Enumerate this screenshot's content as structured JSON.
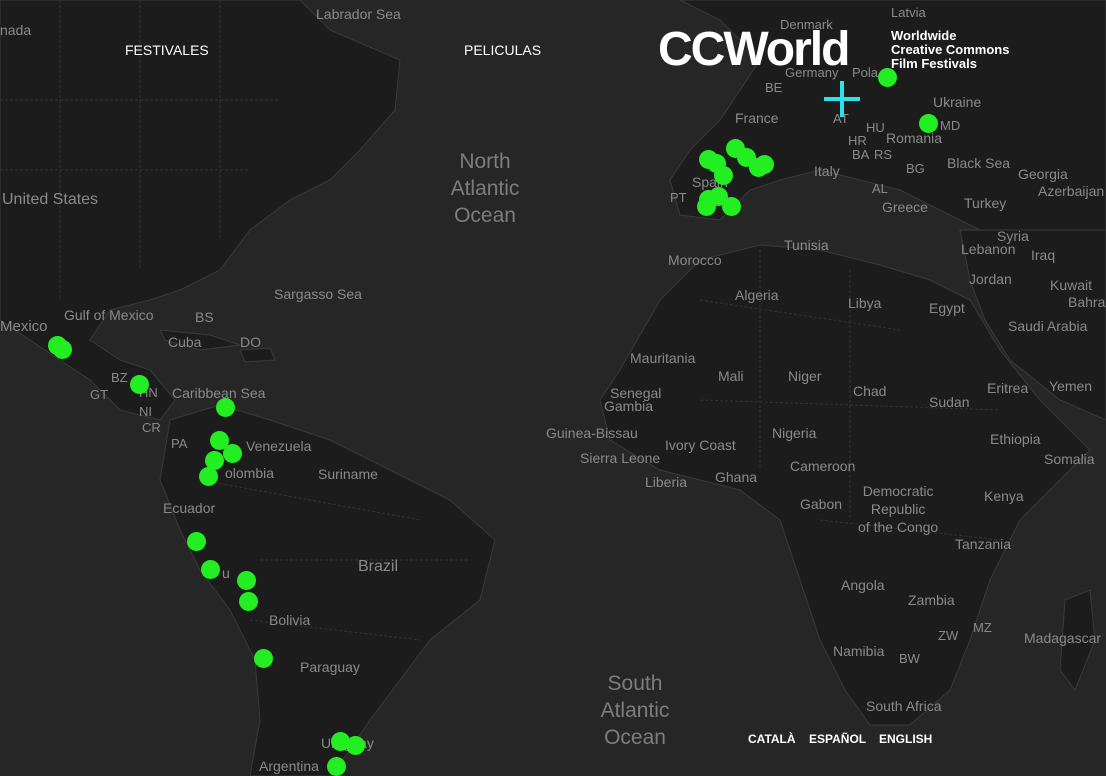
{
  "nav": {
    "festivales": "FESTIVALES",
    "peliculas": "PELICULAS"
  },
  "logo": {
    "wordmark": "CCWorld",
    "tagline": [
      "Worldwide",
      "Creative Commons",
      "Film Festivals"
    ]
  },
  "languages": [
    "CATALÀ",
    "ESPAÑOL",
    "ENGLISH"
  ],
  "colors": {
    "background": "#262626",
    "land": "#1c1c1c",
    "marker": "#22ee22",
    "crosshair": "#2ee0e8"
  },
  "oceans": {
    "north_atlantic": [
      "North",
      "Atlantic",
      "Ocean"
    ],
    "south_atlantic": [
      "South",
      "Atlantic",
      "Ocean"
    ]
  },
  "labels": {
    "labrador_sea": "Labrador Sea",
    "nada": "nada",
    "united_states": "United States",
    "mexico": "Mexico",
    "gulf_of_mexico": "Gulf of Mexico",
    "bs": "BS",
    "cuba": "Cuba",
    "do": "DO",
    "sargasso_sea": "Sargasso Sea",
    "bz": "BZ",
    "gt": "GT",
    "hn": "HN",
    "ni": "NI",
    "cr": "CR",
    "pa": "PA",
    "caribbean_sea": "Caribbean Sea",
    "venezuela": "Venezuela",
    "colombia": "olombia",
    "suriname": "Suriname",
    "ecuador": "Ecuador",
    "peru": "u",
    "brazil": "Brazil",
    "bolivia": "Bolivia",
    "paraguay": "Paraguay",
    "uruguay": "Uruguay",
    "argentina": "Argentina",
    "denmark": "Denmark",
    "latvia": "Latvia",
    "germany": "Germany",
    "poland": "Pola",
    "be": "BE",
    "france": "France",
    "at": "AT",
    "ukraine": "Ukraine",
    "hu": "HU",
    "romania": "Romania",
    "md": "MD",
    "hr": "HR",
    "ba": "BA",
    "rs": "RS",
    "bg": "BG",
    "black_sea": "Black Sea",
    "georgia": "Georgia",
    "azerbaijan": "Azerbaijan",
    "italy": "Italy",
    "al": "AL",
    "greece": "Greece",
    "turkey": "Turkey",
    "spain": "Spain",
    "pt": "PT",
    "syria": "Syria",
    "lebanon": "Lebanon",
    "iraq": "Iraq",
    "tunisia": "Tunisia",
    "jordan": "Jordan",
    "kuwait": "Kuwait",
    "bahrain": "Bahra",
    "morocco": "Morocco",
    "algeria": "Algeria",
    "libya": "Libya",
    "egypt": "Egypt",
    "saudi_arabia": "Saudi Arabia",
    "mauritania": "Mauritania",
    "mali": "Mali",
    "niger": "Niger",
    "chad": "Chad",
    "sudan": "Sudan",
    "eritrea": "Eritrea",
    "yemen": "Yemen",
    "senegal": "Senegal",
    "gambia": "Gambia",
    "guinea_bissau": "Guinea-Bissau",
    "ivory_coast": "Ivory Coast",
    "sierra_leone": "Sierra Leone",
    "liberia": "Liberia",
    "ghana": "Ghana",
    "nigeria": "Nigeria",
    "ethiopia": "Ethiopia",
    "somalia": "Somalia",
    "cameroon": "Cameroon",
    "gabon": "Gabon",
    "drc": [
      "Democratic",
      "Republic",
      "of the Congo"
    ],
    "kenya": "Kenya",
    "tanzania": "Tanzania",
    "angola": "Angola",
    "zambia": "Zambia",
    "zw": "ZW",
    "mz": "MZ",
    "madagascar": "Madagascar",
    "namibia": "Namibia",
    "bw": "BW",
    "south_africa": "South Africa"
  }
}
